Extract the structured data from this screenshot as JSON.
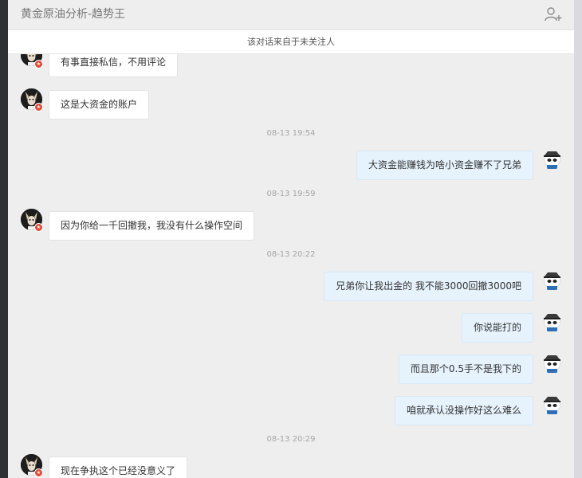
{
  "window": {
    "title": "黄金原油分析-趋势王",
    "notice": "该对话来自于未关注人"
  },
  "icons": {
    "add_user": "add-user-icon",
    "other_avatar": "dog-avatar",
    "self_avatar": "panda-avatar"
  },
  "colors": {
    "self_bubble": "#e6f3fd",
    "other_bubble": "#ffffff",
    "timestamp": "#a6a6a6"
  },
  "messages": [
    {
      "sender": "other",
      "text": "有事直接私信，不用评论"
    },
    {
      "sender": "other",
      "text": "这是大资金的账户"
    },
    {
      "type": "time",
      "text": "08-13 19:54"
    },
    {
      "sender": "self",
      "text": "大资金能赚钱为啥小资金赚不了兄弟"
    },
    {
      "type": "time",
      "text": "08-13 19:59"
    },
    {
      "sender": "other",
      "text": "因为你给一千回撤我，我没有什么操作空间"
    },
    {
      "type": "time",
      "text": "08-13 20:22"
    },
    {
      "sender": "self",
      "text": "兄弟你让我出金的  我不能3000回撤3000吧"
    },
    {
      "sender": "self",
      "text": "你说能打的"
    },
    {
      "sender": "self",
      "text": "而且那个0.5手不是我下的"
    },
    {
      "sender": "self",
      "text": "咱就承认没操作好这么难么"
    },
    {
      "type": "time",
      "text": "08-13 20:29"
    },
    {
      "sender": "other",
      "text": "现在争执这个已经没意义了"
    }
  ]
}
